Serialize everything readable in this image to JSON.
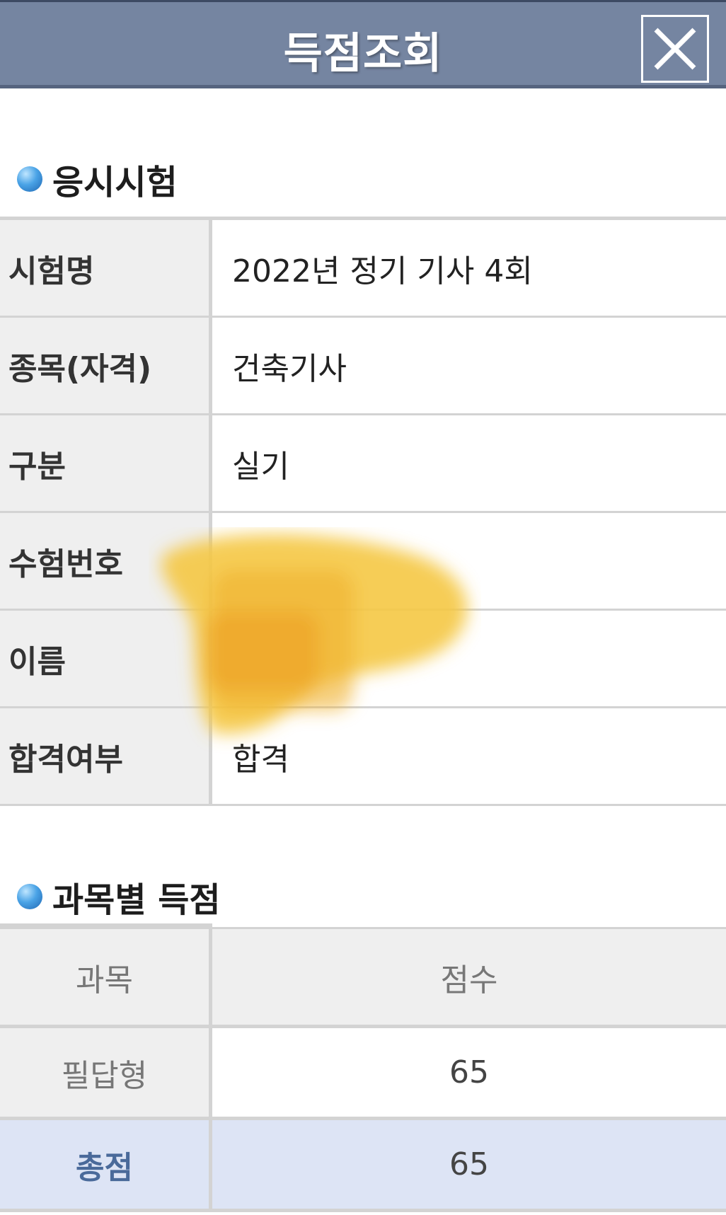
{
  "header": {
    "title": "득점조회",
    "close_icon": "close-icon"
  },
  "exam_section": {
    "title": "응시시험",
    "rows": [
      {
        "label": "시험명",
        "value": "2022년 정기 기사 4회"
      },
      {
        "label": "종목(자격)",
        "value": "건축기사"
      },
      {
        "label": "구분",
        "value": "실기"
      },
      {
        "label": "수험번호",
        "value": ""
      },
      {
        "label": "이름",
        "value": ""
      },
      {
        "label": "합격여부",
        "value": "합격"
      }
    ]
  },
  "score_section": {
    "title": "과목별 득점",
    "header": {
      "subject": "과목",
      "score": "점수"
    },
    "rows": [
      {
        "subject": "필답형",
        "score": "65"
      }
    ],
    "total": {
      "label": "총점",
      "score": "65"
    }
  },
  "colors": {
    "header_bg": "#7585a1",
    "total_row_bg": "#dde4f5",
    "total_label": "#4a6a9a",
    "redaction": "#f2c230"
  }
}
